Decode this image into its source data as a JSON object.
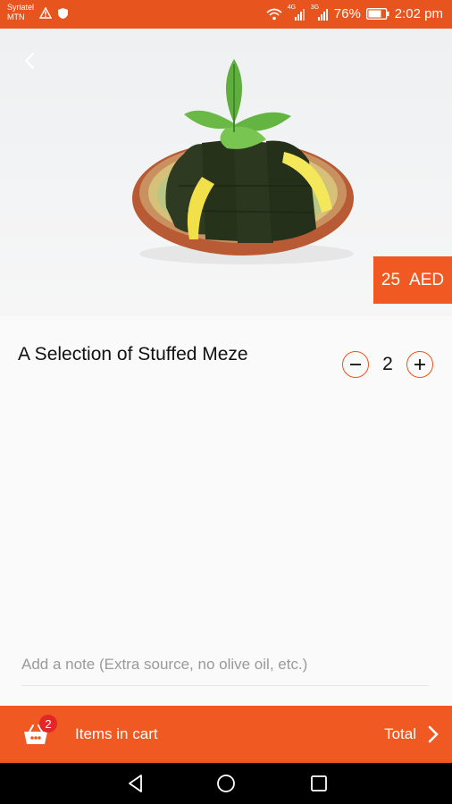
{
  "status_bar": {
    "carrier_line1": "Syriatel",
    "carrier_line2": "MTN",
    "signal1_label": "4G",
    "signal2_label": "3G",
    "battery": "76%",
    "time": "2:02 pm"
  },
  "product": {
    "name": "A Selection of Stuffed Meze",
    "price_value": "25",
    "price_currency": "AED",
    "quantity": "2"
  },
  "note": {
    "placeholder": "Add a note (Extra source, no olive oil, etc.)"
  },
  "cart": {
    "badge_count": "2",
    "items_label": "Items in cart",
    "total_label": "Total"
  },
  "colors": {
    "accent": "#f05a22",
    "status_bar": "#e8541e",
    "badge": "#e02828"
  }
}
